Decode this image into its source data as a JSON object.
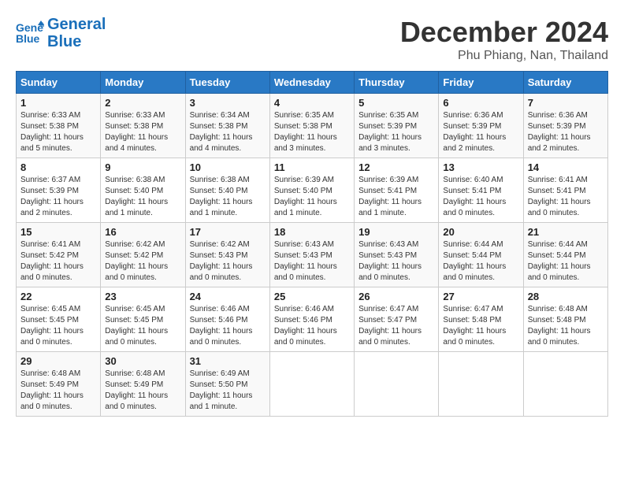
{
  "header": {
    "logo_line1": "General",
    "logo_line2": "Blue",
    "month": "December 2024",
    "location": "Phu Phiang, Nan, Thailand"
  },
  "days_of_week": [
    "Sunday",
    "Monday",
    "Tuesday",
    "Wednesday",
    "Thursday",
    "Friday",
    "Saturday"
  ],
  "weeks": [
    [
      {
        "day": "1",
        "sunrise": "6:33 AM",
        "sunset": "5:38 PM",
        "daylight": "11 hours and 5 minutes."
      },
      {
        "day": "2",
        "sunrise": "6:33 AM",
        "sunset": "5:38 PM",
        "daylight": "11 hours and 4 minutes."
      },
      {
        "day": "3",
        "sunrise": "6:34 AM",
        "sunset": "5:38 PM",
        "daylight": "11 hours and 4 minutes."
      },
      {
        "day": "4",
        "sunrise": "6:35 AM",
        "sunset": "5:38 PM",
        "daylight": "11 hours and 3 minutes."
      },
      {
        "day": "5",
        "sunrise": "6:35 AM",
        "sunset": "5:39 PM",
        "daylight": "11 hours and 3 minutes."
      },
      {
        "day": "6",
        "sunrise": "6:36 AM",
        "sunset": "5:39 PM",
        "daylight": "11 hours and 2 minutes."
      },
      {
        "day": "7",
        "sunrise": "6:36 AM",
        "sunset": "5:39 PM",
        "daylight": "11 hours and 2 minutes."
      }
    ],
    [
      {
        "day": "8",
        "sunrise": "6:37 AM",
        "sunset": "5:39 PM",
        "daylight": "11 hours and 2 minutes."
      },
      {
        "day": "9",
        "sunrise": "6:38 AM",
        "sunset": "5:40 PM",
        "daylight": "11 hours and 1 minute."
      },
      {
        "day": "10",
        "sunrise": "6:38 AM",
        "sunset": "5:40 PM",
        "daylight": "11 hours and 1 minute."
      },
      {
        "day": "11",
        "sunrise": "6:39 AM",
        "sunset": "5:40 PM",
        "daylight": "11 hours and 1 minute."
      },
      {
        "day": "12",
        "sunrise": "6:39 AM",
        "sunset": "5:41 PM",
        "daylight": "11 hours and 1 minute."
      },
      {
        "day": "13",
        "sunrise": "6:40 AM",
        "sunset": "5:41 PM",
        "daylight": "11 hours and 0 minutes."
      },
      {
        "day": "14",
        "sunrise": "6:41 AM",
        "sunset": "5:41 PM",
        "daylight": "11 hours and 0 minutes."
      }
    ],
    [
      {
        "day": "15",
        "sunrise": "6:41 AM",
        "sunset": "5:42 PM",
        "daylight": "11 hours and 0 minutes."
      },
      {
        "day": "16",
        "sunrise": "6:42 AM",
        "sunset": "5:42 PM",
        "daylight": "11 hours and 0 minutes."
      },
      {
        "day": "17",
        "sunrise": "6:42 AM",
        "sunset": "5:43 PM",
        "daylight": "11 hours and 0 minutes."
      },
      {
        "day": "18",
        "sunrise": "6:43 AM",
        "sunset": "5:43 PM",
        "daylight": "11 hours and 0 minutes."
      },
      {
        "day": "19",
        "sunrise": "6:43 AM",
        "sunset": "5:43 PM",
        "daylight": "11 hours and 0 minutes."
      },
      {
        "day": "20",
        "sunrise": "6:44 AM",
        "sunset": "5:44 PM",
        "daylight": "11 hours and 0 minutes."
      },
      {
        "day": "21",
        "sunrise": "6:44 AM",
        "sunset": "5:44 PM",
        "daylight": "11 hours and 0 minutes."
      }
    ],
    [
      {
        "day": "22",
        "sunrise": "6:45 AM",
        "sunset": "5:45 PM",
        "daylight": "11 hours and 0 minutes."
      },
      {
        "day": "23",
        "sunrise": "6:45 AM",
        "sunset": "5:45 PM",
        "daylight": "11 hours and 0 minutes."
      },
      {
        "day": "24",
        "sunrise": "6:46 AM",
        "sunset": "5:46 PM",
        "daylight": "11 hours and 0 minutes."
      },
      {
        "day": "25",
        "sunrise": "6:46 AM",
        "sunset": "5:46 PM",
        "daylight": "11 hours and 0 minutes."
      },
      {
        "day": "26",
        "sunrise": "6:47 AM",
        "sunset": "5:47 PM",
        "daylight": "11 hours and 0 minutes."
      },
      {
        "day": "27",
        "sunrise": "6:47 AM",
        "sunset": "5:48 PM",
        "daylight": "11 hours and 0 minutes."
      },
      {
        "day": "28",
        "sunrise": "6:48 AM",
        "sunset": "5:48 PM",
        "daylight": "11 hours and 0 minutes."
      }
    ],
    [
      {
        "day": "29",
        "sunrise": "6:48 AM",
        "sunset": "5:49 PM",
        "daylight": "11 hours and 0 minutes."
      },
      {
        "day": "30",
        "sunrise": "6:48 AM",
        "sunset": "5:49 PM",
        "daylight": "11 hours and 0 minutes."
      },
      {
        "day": "31",
        "sunrise": "6:49 AM",
        "sunset": "5:50 PM",
        "daylight": "11 hours and 1 minute."
      },
      null,
      null,
      null,
      null
    ]
  ]
}
